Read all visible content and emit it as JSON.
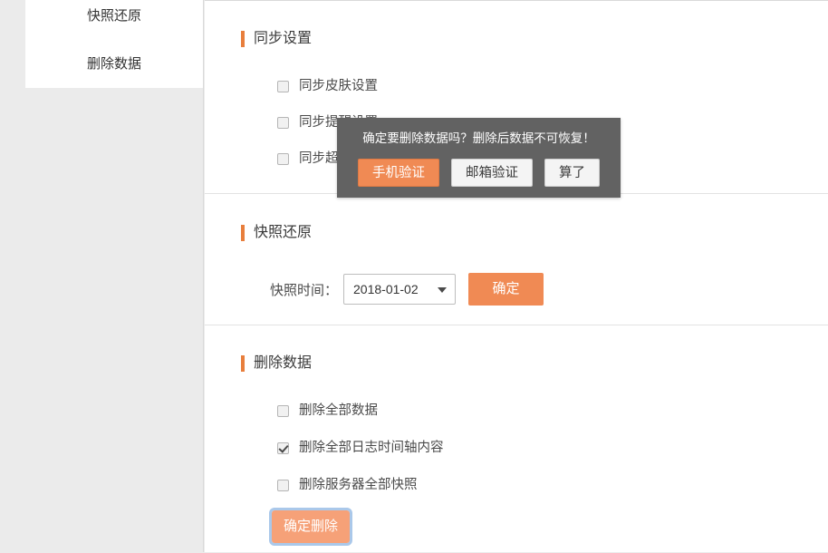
{
  "sidebar": {
    "items": [
      {
        "label": "快照还原"
      },
      {
        "label": "删除数据"
      }
    ]
  },
  "sections": {
    "sync": {
      "title": "同步设置",
      "checkboxes": [
        {
          "label": "同步皮肤设置",
          "checked": false
        },
        {
          "label": "同步提醒设置",
          "checked": false
        },
        {
          "label": "同步超链识别设置",
          "checked": false
        }
      ]
    },
    "snapshot": {
      "title": "快照还原",
      "time_label": "快照时间：",
      "selected_date": "2018-01-02",
      "confirm_label": "确定"
    },
    "delete": {
      "title": "删除数据",
      "checkboxes": [
        {
          "label": "删除全部数据",
          "checked": false
        },
        {
          "label": "删除全部日志时间轴内容",
          "checked": true
        },
        {
          "label": "删除服务器全部快照",
          "checked": false
        }
      ],
      "confirm_delete_label": "确定删除"
    }
  },
  "dialog": {
    "message": "确定要删除数据吗？删除后数据不可恢复！",
    "buttons": [
      {
        "label": "手机验证",
        "style": "primary"
      },
      {
        "label": "邮箱验证",
        "style": "plain"
      },
      {
        "label": "算了",
        "style": "plain"
      }
    ]
  },
  "colors": {
    "accent": "#e87e3c",
    "button_orange": "#f08a54",
    "button_orange_light": "#f6a178",
    "dialog_bg": "#626262",
    "focus_ring": "#aac8ea",
    "page_bg": "#ebebeb"
  }
}
